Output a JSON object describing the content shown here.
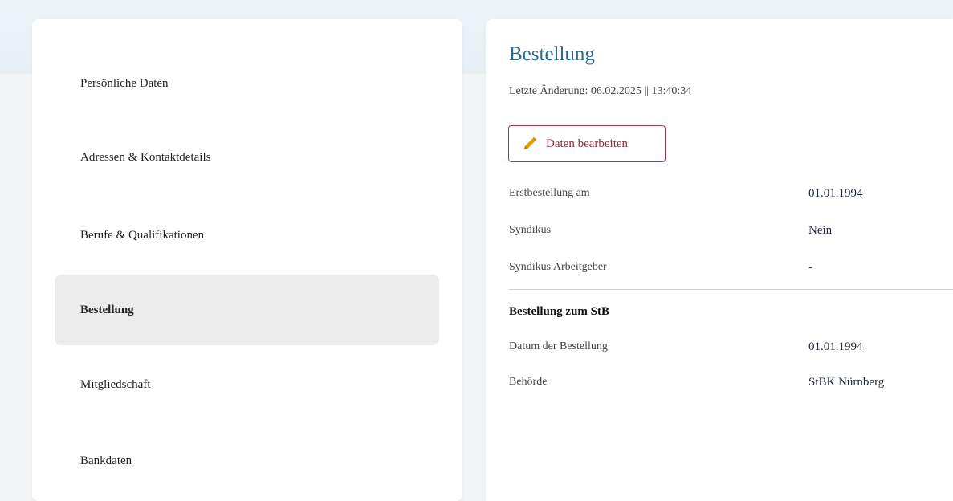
{
  "sidebar": {
    "items": [
      {
        "label": "Persönliche Daten",
        "active": false
      },
      {
        "label": "Adressen & Kontaktdetails",
        "active": false
      },
      {
        "label": "Berufe & Qualifikationen",
        "active": false
      },
      {
        "label": "Bestellung",
        "active": true
      },
      {
        "label": "Mitgliedschaft",
        "active": false
      },
      {
        "label": "Bankdaten",
        "active": false
      }
    ]
  },
  "main": {
    "title": "Bestellung",
    "last_change": "Letzte Änderung: 06.02.2025 || 13:40:34",
    "edit_button": {
      "label": "Daten bearbeiten",
      "icon": "pencil-icon"
    },
    "fields": [
      {
        "label": "Erstbestellung am",
        "value": "01.01.1994"
      },
      {
        "label": "Syndikus",
        "value": "Nein"
      },
      {
        "label": "Syndikus Arbeitgeber",
        "value": "-"
      }
    ],
    "section": {
      "heading": "Bestellung zum StB",
      "fields": [
        {
          "label": "Datum der Bestellung",
          "value": "01.01.1994"
        },
        {
          "label": "Behörde",
          "value": "StBK Nürnberg"
        }
      ]
    }
  },
  "colors": {
    "title": "#2c6a8e",
    "accent": "#8d2a40",
    "active_bg": "#ececec",
    "pencil": "#e0a100"
  }
}
